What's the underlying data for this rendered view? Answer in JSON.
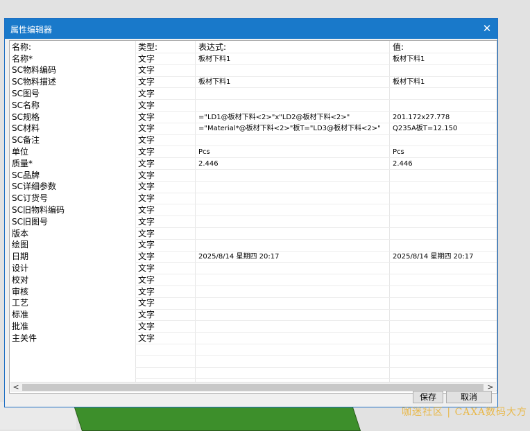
{
  "dialog": {
    "title": "属性编辑器",
    "close_icon": "close-icon",
    "save_label": "保存",
    "cancel_label": "取消"
  },
  "table": {
    "columns": [
      "名称:",
      "类型:",
      "表达式:",
      "值:"
    ],
    "rows": [
      {
        "name": "名称*",
        "type": "文字",
        "expr": "板材下料1",
        "value": "板材下料1"
      },
      {
        "name": "SC物料编码",
        "type": "文字",
        "expr": "",
        "value": ""
      },
      {
        "name": "SC物料描述",
        "type": "文字",
        "expr": "板材下料1",
        "value": "板材下料1"
      },
      {
        "name": "SC图号",
        "type": "文字",
        "expr": "",
        "value": ""
      },
      {
        "name": "SC名称",
        "type": "文字",
        "expr": "",
        "value": ""
      },
      {
        "name": "SC规格",
        "type": "文字",
        "expr": "=\"LD1@板材下料<2>\"x\"LD2@板材下料<2>\"",
        "value": "201.172x27.778"
      },
      {
        "name": "SC材料",
        "type": "文字",
        "expr": "=\"Material*@板材下料<2>\"板T=\"LD3@板材下料<2>\"",
        "value": "Q235A板T=12.150"
      },
      {
        "name": "SC备注",
        "type": "文字",
        "expr": "",
        "value": ""
      },
      {
        "name": "单位",
        "type": "文字",
        "expr": "Pcs",
        "value": "Pcs"
      },
      {
        "name": "质量*",
        "type": "文字",
        "expr": "2.446",
        "value": "2.446"
      },
      {
        "name": "SC品牌",
        "type": "文字",
        "expr": "",
        "value": ""
      },
      {
        "name": "SC详细参数",
        "type": "文字",
        "expr": "",
        "value": ""
      },
      {
        "name": "SC订货号",
        "type": "文字",
        "expr": "",
        "value": ""
      },
      {
        "name": "SC旧物料编码",
        "type": "文字",
        "expr": "",
        "value": ""
      },
      {
        "name": "SC旧图号",
        "type": "文字",
        "expr": "",
        "value": ""
      },
      {
        "name": "版本",
        "type": "文字",
        "expr": "",
        "value": ""
      },
      {
        "name": "绘图",
        "type": "文字",
        "expr": "",
        "value": ""
      },
      {
        "name": "日期",
        "type": "文字",
        "expr": "2025/8/14 星期四 20:17",
        "value": "2025/8/14 星期四 20:17"
      },
      {
        "name": "设计",
        "type": "文字",
        "expr": "",
        "value": ""
      },
      {
        "name": "校对",
        "type": "文字",
        "expr": "",
        "value": ""
      },
      {
        "name": "审核",
        "type": "文字",
        "expr": "",
        "value": ""
      },
      {
        "name": "工艺",
        "type": "文字",
        "expr": "",
        "value": ""
      },
      {
        "name": "标准",
        "type": "文字",
        "expr": "",
        "value": ""
      },
      {
        "name": "批准",
        "type": "文字",
        "expr": "",
        "value": ""
      },
      {
        "name": "主关件",
        "type": "文字",
        "expr": "",
        "value": ""
      }
    ]
  },
  "scrollbar": {
    "left_icon": "chevron-left-icon",
    "right_icon": "chevron-right-icon",
    "left_glyph": "<",
    "right_glyph": ">"
  },
  "watermark": "咖迷社区 | CAXA数码大方",
  "colors": {
    "titlebar": "#1979ca",
    "watermark": "#e8b84a"
  }
}
